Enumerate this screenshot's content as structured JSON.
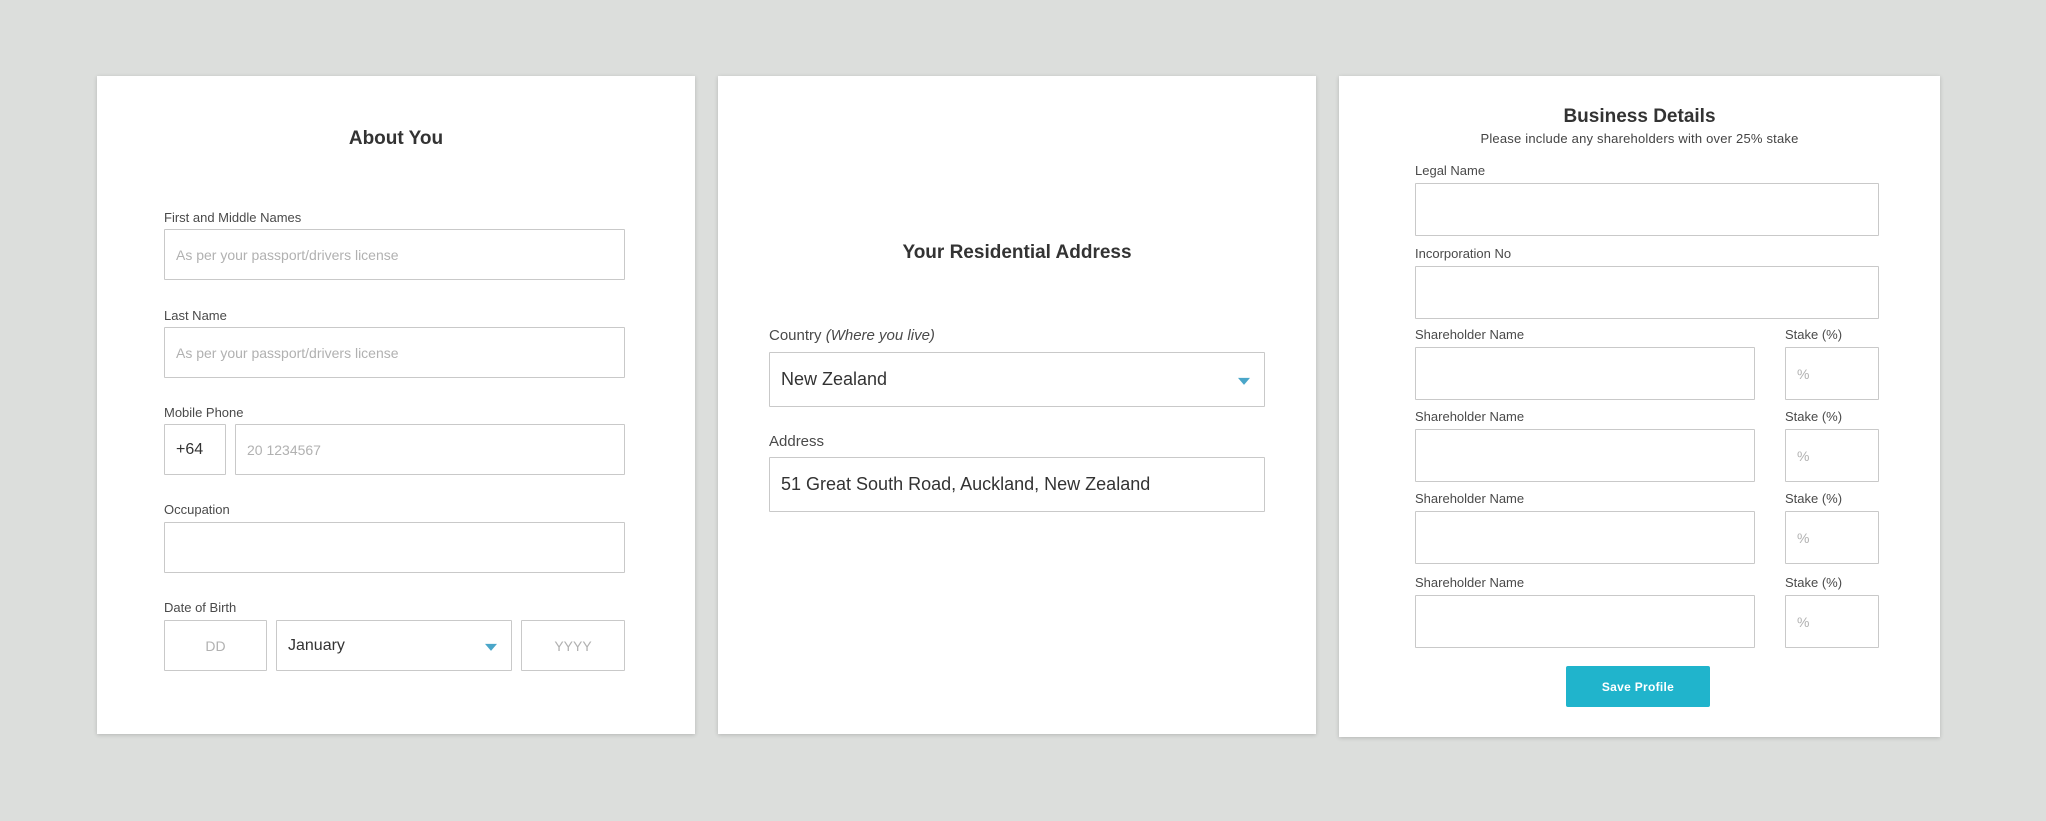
{
  "about": {
    "title": "About You",
    "first_names": {
      "label": "First and Middle Names",
      "placeholder": "As per your passport/drivers license",
      "value": ""
    },
    "last_name": {
      "label": "Last Name",
      "placeholder": "As per your passport/drivers license",
      "value": ""
    },
    "mobile": {
      "label": "Mobile Phone",
      "country_code": "+64",
      "placeholder": "20 1234567",
      "value": ""
    },
    "occupation": {
      "label": "Occupation",
      "value": ""
    },
    "dob": {
      "label": "Date of Birth",
      "day_placeholder": "DD",
      "month": "January",
      "year_placeholder": "YYYY"
    }
  },
  "address": {
    "title": "Your Residential Address",
    "country_label": "Country",
    "country_hint": "(Where you live)",
    "country_value": "New Zealand",
    "address_label": "Address",
    "address_value": "51 Great South Road, Auckland, New Zealand"
  },
  "business": {
    "title": "Business Details",
    "subtitle": "Please include any shareholders with over 25% stake",
    "legal_name": {
      "label": "Legal Name",
      "value": ""
    },
    "incorporation": {
      "label": "Incorporation No",
      "value": ""
    },
    "shareholders": [
      {
        "name_label": "Shareholder Name",
        "stake_label": "Stake (%)",
        "stake_placeholder": "%"
      },
      {
        "name_label": "Shareholder Name",
        "stake_label": "Stake (%)",
        "stake_placeholder": "%"
      },
      {
        "name_label": "Shareholder Name",
        "stake_label": "Stake (%)",
        "stake_placeholder": "%"
      },
      {
        "name_label": "Shareholder Name",
        "stake_label": "Stake (%)",
        "stake_placeholder": "%"
      }
    ],
    "save_label": "Save Profile"
  },
  "icons": {
    "dropdown": "chevron-down-icon"
  },
  "colors": {
    "accent": "#20b4cc",
    "caret": "#4aa6c9",
    "background": "#dcdedc"
  }
}
